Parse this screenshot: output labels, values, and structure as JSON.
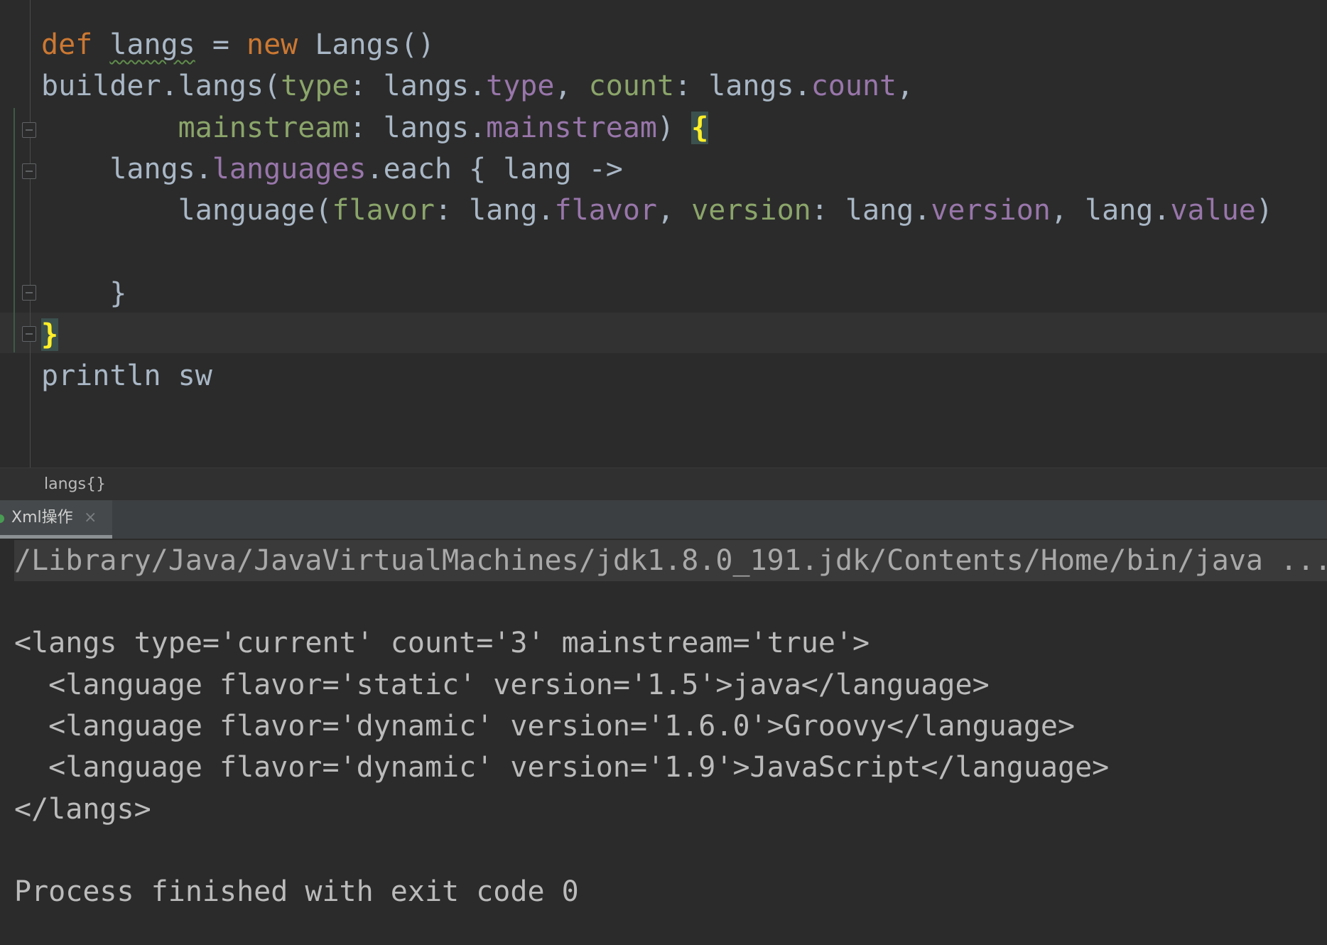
{
  "editor": {
    "lines": [
      {
        "tokens": [
          {
            "t": "def",
            "c": "kw"
          },
          {
            "t": " ",
            "c": "pn"
          },
          {
            "t": "langs",
            "c": "id",
            "squiggle": true
          },
          {
            "t": " = ",
            "c": "pn"
          },
          {
            "t": "new",
            "c": "kw"
          },
          {
            "t": " Langs()",
            "c": "cls"
          }
        ]
      },
      {
        "tokens": [
          {
            "t": "builder.langs(",
            "c": "pn"
          },
          {
            "t": "type",
            "c": "nm"
          },
          {
            "t": ": langs.",
            "c": "pn"
          },
          {
            "t": "type",
            "c": "pr"
          },
          {
            "t": ", ",
            "c": "pn"
          },
          {
            "t": "count",
            "c": "nm"
          },
          {
            "t": ": langs.",
            "c": "pn"
          },
          {
            "t": "count",
            "c": "pr"
          },
          {
            "t": ",",
            "c": "pn"
          }
        ]
      },
      {
        "tokens": [
          {
            "t": "        ",
            "c": "pn"
          },
          {
            "t": "mainstream",
            "c": "nm"
          },
          {
            "t": ": langs.",
            "c": "pn"
          },
          {
            "t": "mainstream",
            "c": "pr"
          },
          {
            "t": ") ",
            "c": "pn"
          },
          {
            "t": "{",
            "c": "brace-hl"
          }
        ]
      },
      {
        "tokens": [
          {
            "t": "    langs.",
            "c": "pn"
          },
          {
            "t": "languages",
            "c": "pr"
          },
          {
            "t": ".each { lang ->",
            "c": "pn"
          }
        ]
      },
      {
        "tokens": [
          {
            "t": "        language(",
            "c": "pn"
          },
          {
            "t": "flavor",
            "c": "nm"
          },
          {
            "t": ": lang.",
            "c": "pn"
          },
          {
            "t": "flavor",
            "c": "pr"
          },
          {
            "t": ", ",
            "c": "pn"
          },
          {
            "t": "version",
            "c": "nm"
          },
          {
            "t": ": lang.",
            "c": "pn"
          },
          {
            "t": "version",
            "c": "pr"
          },
          {
            "t": ", lang.",
            "c": "pn"
          },
          {
            "t": "value",
            "c": "pr"
          },
          {
            "t": ")",
            "c": "pn"
          }
        ]
      },
      {
        "tokens": []
      },
      {
        "tokens": [
          {
            "t": "    }",
            "c": "pn"
          }
        ]
      },
      {
        "tokens": [
          {
            "t": "}",
            "c": "brace-hl"
          }
        ]
      },
      {
        "tokens": [
          {
            "t": "println sw",
            "c": "pn"
          }
        ]
      }
    ]
  },
  "breadcrumb": {
    "label": "langs{}"
  },
  "run_panel": {
    "tab_label": "Xml操作",
    "close_glyph": "×"
  },
  "console": {
    "command": "/Library/Java/JavaVirtualMachines/jdk1.8.0_191.jdk/Contents/Home/bin/java ...",
    "output_lines": [
      "",
      "<langs type='current' count='3' mainstream='true'>",
      "  <language flavor='static' version='1.5'>java</language>",
      "  <language flavor='dynamic' version='1.6.0'>Groovy</language>",
      "  <language flavor='dynamic' version='1.9'>JavaScript</language>",
      "</langs>",
      "",
      "Process finished with exit code 0"
    ]
  },
  "colors": {
    "background": "#2b2b2b",
    "keyword": "#cc7832",
    "named_arg": "#8ba56a",
    "property": "#9876aa",
    "plain": "#a9b7c6",
    "brace_highlight": "#ffef28",
    "run_ok": "#499c54"
  }
}
